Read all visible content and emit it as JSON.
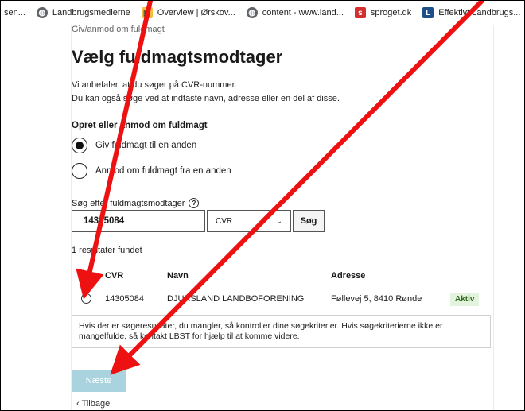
{
  "bookmarks": [
    {
      "label": "sen...",
      "icon": ""
    },
    {
      "label": "Landbrugsmedierne",
      "icon": "globe-icon"
    },
    {
      "label": "Overview | Ørskov...",
      "icon": "overview-icon"
    },
    {
      "label": "content - www.land...",
      "icon": "globe-icon"
    },
    {
      "label": "sproget.dk",
      "icon": "sproget-icon"
    },
    {
      "label": "Effektivt Landbrugs...",
      "icon": "L-icon"
    }
  ],
  "page": {
    "breadcrumb": "Giv/anmod om fuldmagt",
    "title": "Vælg fuldmagtsmodtager",
    "intro_1": "Vi anbefaler, at du søger på CVR-nummer.",
    "intro_2": "Du kan også søge ved at indtaste navn, adresse eller en del af disse.",
    "section_title": "Opret eller anmod om fuldmagt",
    "options": [
      {
        "label": "Giv fuldmagt til en anden",
        "selected": true
      },
      {
        "label": "Anmod om fuldmagt fra en anden",
        "selected": false
      }
    ],
    "search_label": "Søg efter fuldmagtsmodtager",
    "search_value": "14305084",
    "search_type": "CVR",
    "search_button": "Søg",
    "result_count": "1 resultater fundet",
    "table": {
      "headers": [
        "",
        "CVR",
        "Navn",
        "Adresse",
        ""
      ],
      "rows": [
        {
          "cvr": "14305084",
          "name": "DJURSLAND LANDBOFORENING",
          "address": "Føllevej 5, 8410 Rønde",
          "status": "Aktiv"
        }
      ]
    },
    "notice": "Hvis der er søgeresultater, du mangler, så kontroller dine søgekriterier. Hvis søgekriterierne ikke er mangelfulde, så kontakt LBST for hjælp til at komme videre.",
    "next_button": "Næste",
    "back_link": "Tilbage"
  },
  "colors": {
    "accent_disabled": "#a9d3de",
    "status_bg": "#e4f3dd",
    "arrow": "#ee1111"
  }
}
